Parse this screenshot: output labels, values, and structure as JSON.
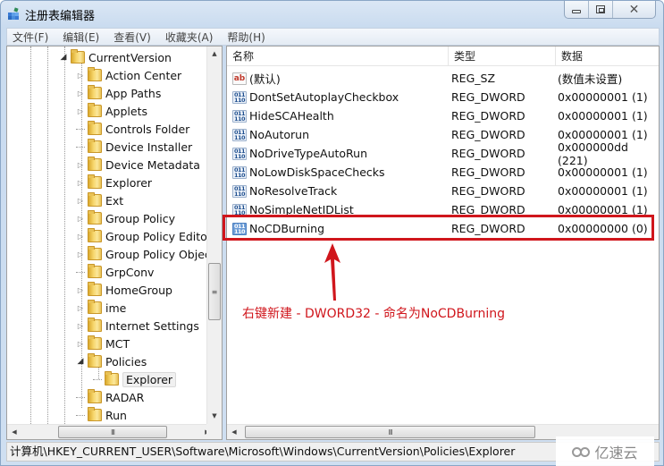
{
  "window": {
    "title": "注册表编辑器",
    "buttons": {
      "minimize": "minimize",
      "maximize": "maximize",
      "close": "close"
    }
  },
  "menu": [
    {
      "label": "文件(F)"
    },
    {
      "label": "编辑(E)"
    },
    {
      "label": "查看(V)"
    },
    {
      "label": "收藏夹(A)"
    },
    {
      "label": "帮助(H)"
    }
  ],
  "tree": {
    "root": {
      "label": "CurrentVersion",
      "expanded": true
    },
    "items": [
      {
        "label": "Action Center",
        "expander": "collapsed"
      },
      {
        "label": "App Paths",
        "expander": "collapsed"
      },
      {
        "label": "Applets",
        "expander": "collapsed"
      },
      {
        "label": "Controls Folder",
        "expander": "none"
      },
      {
        "label": "Device Installer",
        "expander": "none"
      },
      {
        "label": "Device Metadata",
        "expander": "collapsed"
      },
      {
        "label": "Explorer",
        "expander": "collapsed"
      },
      {
        "label": "Ext",
        "expander": "collapsed"
      },
      {
        "label": "Group Policy",
        "expander": "collapsed"
      },
      {
        "label": "Group Policy Editor",
        "expander": "collapsed"
      },
      {
        "label": "Group Policy Objects",
        "expander": "collapsed"
      },
      {
        "label": "GrpConv",
        "expander": "none"
      },
      {
        "label": "HomeGroup",
        "expander": "collapsed"
      },
      {
        "label": "ime",
        "expander": "collapsed"
      },
      {
        "label": "Internet Settings",
        "expander": "collapsed"
      },
      {
        "label": "MCT",
        "expander": "collapsed"
      },
      {
        "label": "Policies",
        "expander": "expanded"
      },
      {
        "label": "Explorer",
        "expander": "none",
        "child": true,
        "selected": true
      },
      {
        "label": "RADAR",
        "expander": "none"
      },
      {
        "label": "Run",
        "expander": "none"
      }
    ],
    "hscroll_thumb": "III"
  },
  "values": {
    "columns": {
      "name": "名称",
      "type": "类型",
      "data": "数据"
    },
    "rows": [
      {
        "icon": "string-value-icon",
        "icon_text": "ab",
        "name": "(默认)",
        "type": "REG_SZ",
        "data": "(数值未设置)"
      },
      {
        "icon": "binary-value-icon",
        "icon_text": "011\n110",
        "name": "DontSetAutoplayCheckbox",
        "type": "REG_DWORD",
        "data": "0x00000001 (1)"
      },
      {
        "icon": "binary-value-icon",
        "icon_text": "011\n110",
        "name": "HideSCAHealth",
        "type": "REG_DWORD",
        "data": "0x00000001 (1)"
      },
      {
        "icon": "binary-value-icon",
        "icon_text": "011\n110",
        "name": "NoAutorun",
        "type": "REG_DWORD",
        "data": "0x00000001 (1)"
      },
      {
        "icon": "binary-value-icon",
        "icon_text": "011\n110",
        "name": "NoDriveTypeAutoRun",
        "type": "REG_DWORD",
        "data": "0x000000dd (221)"
      },
      {
        "icon": "binary-value-icon",
        "icon_text": "011\n110",
        "name": "NoLowDiskSpaceChecks",
        "type": "REG_DWORD",
        "data": "0x00000001 (1)"
      },
      {
        "icon": "binary-value-icon",
        "icon_text": "011\n110",
        "name": "NoResolveTrack",
        "type": "REG_DWORD",
        "data": "0x00000001 (1)"
      },
      {
        "icon": "binary-value-icon",
        "icon_text": "011\n110",
        "name": "NoSimpleNetIDList",
        "type": "REG_DWORD",
        "data": "0x00000001 (1)"
      },
      {
        "icon": "binary-value-icon",
        "icon_text": "011\n110",
        "name": "NoCDBurning",
        "type": "REG_DWORD",
        "data": "0x00000000 (0)",
        "selected": true
      }
    ],
    "hscroll_thumb": "III"
  },
  "annotation": {
    "text": "右键新建 - DWORD32 - 命名为NoCDBurning",
    "color": "#d0161c"
  },
  "statusbar": {
    "path": "计算机\\HKEY_CURRENT_USER\\Software\\Microsoft\\Windows\\CurrentVersion\\Policies\\Explorer"
  },
  "watermark": {
    "text": "亿速云"
  }
}
